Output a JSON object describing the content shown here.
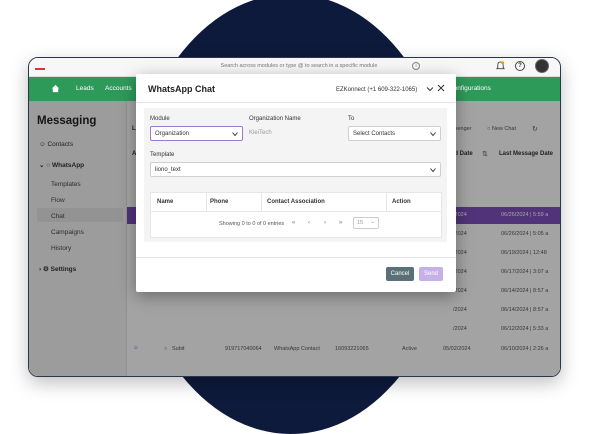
{
  "topbar": {
    "search_placeholder": "Search across modules or type @ to search in a specific module",
    "info_icon": "i",
    "help_icon": "?"
  },
  "nav": {
    "items": [
      "Leads",
      "Accounts",
      "Configurations"
    ]
  },
  "sidebar": {
    "title": "Messaging",
    "contacts": "Contacts",
    "whatsapp": "WhatsApp",
    "subitems": [
      "Templates",
      "Flow",
      "Chat",
      "Campaigns",
      "History"
    ],
    "settings": "Settings"
  },
  "main": {
    "messenger": "ssenger",
    "new_chat": "New Chat",
    "cols": [
      "L",
      "A",
      "ted Date",
      "Last Message Date"
    ],
    "created_dates": [
      "/2024",
      "/2024",
      "/2024",
      "/2024",
      "/2024",
      "/2024",
      "/2024",
      "05/02/2024"
    ],
    "last_dates": [
      "06/26/2024 | 5:59 a",
      "06/26/2024 | 5:05 a",
      "06/19/2024 | 12:48",
      "06/17/2024 | 3:07 a",
      "06/14/2024 | 8:57 a",
      "06/14/2024 | 8:57 a",
      "06/12/2024 | 5:33 a",
      "06/10/2024 | 2:26 a"
    ],
    "last_row": {
      "name": "Subit",
      "phone": "919717040064",
      "assoc": "WhatsApp Contact",
      "num": "16093221065",
      "status": "Active"
    }
  },
  "dialog": {
    "title": "WhatsApp Chat",
    "phone_number": "EZKonnect (+1 609-322-1065)",
    "module_label": "Module",
    "module_value": "Organization",
    "org_label": "Organization Name",
    "org_value": "KleiTech",
    "to_label": "To",
    "to_value": "Select Contacts",
    "template_label": "Template",
    "template_value": "liono_text",
    "columns": [
      "Name",
      "Phone",
      "Contact Association",
      "Action"
    ],
    "entries_text": "Showing 0 to 0 of 0 entries",
    "pager": [
      "«",
      "‹",
      "›",
      "»"
    ],
    "page_size": "15",
    "cancel": "Cancel",
    "send": "Send"
  }
}
